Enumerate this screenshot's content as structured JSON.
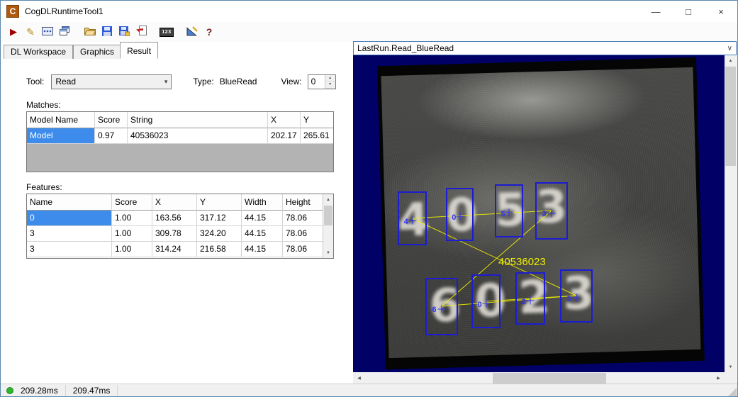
{
  "window": {
    "title": "CogDLRuntimeTool1",
    "icon_letter": "C",
    "controls": {
      "minimize": "—",
      "maximize": "□",
      "close": "×"
    }
  },
  "icons": {
    "play": "▶",
    "pencil": "✎",
    "numbers": "123",
    "help": "?",
    "combo_arrow": "▾",
    "selector_chevron": "∨",
    "spinner_up": "▲",
    "spinner_down": "▼",
    "scroll_up": "▲",
    "scroll_down": "▼",
    "scroll_left": "◀",
    "scroll_right": "▶"
  },
  "tabs": {
    "items": [
      {
        "label": "DL Workspace"
      },
      {
        "label": "Graphics"
      },
      {
        "label": "Result"
      }
    ]
  },
  "result_panel": {
    "tool_label": "Tool:",
    "tool_value": "Read",
    "type_label": "Type:",
    "type_value": "BlueRead",
    "view_label": "View:",
    "view_value": "0",
    "matches_label": "Matches:",
    "matches_table": {
      "headers": [
        "Model Name",
        "Score",
        "String",
        "X",
        "Y"
      ],
      "rows": [
        [
          "Model",
          "0.97",
          "40536023",
          "202.17",
          "265.61"
        ]
      ]
    },
    "features_label": "Features:",
    "features_table": {
      "headers": [
        "Name",
        "Score",
        "X",
        "Y",
        "Width",
        "Height"
      ],
      "rows": [
        [
          "0",
          "1.00",
          "163.56",
          "317.12",
          "44.15",
          "78.06"
        ],
        [
          "3",
          "1.00",
          "309.78",
          "324.20",
          "44.15",
          "78.06"
        ],
        [
          "3",
          "1.00",
          "314.24",
          "216.58",
          "44.15",
          "78.06"
        ]
      ]
    }
  },
  "display_panel": {
    "selector_value": "LastRun.Read_BlueRead",
    "overlay_string": "40536023",
    "boxes": [
      {
        "label": "4"
      },
      {
        "label": "0"
      },
      {
        "label": "5"
      },
      {
        "label": "3"
      },
      {
        "label": "6"
      },
      {
        "label": "0"
      },
      {
        "label": "2"
      },
      {
        "label": "3"
      }
    ],
    "photo_digits": [
      "4",
      "0",
      "5",
      "3",
      "6",
      "0",
      "2",
      "3"
    ]
  },
  "status_bar": {
    "time1": "209.28ms",
    "time2": "209.47ms"
  },
  "colors": {
    "selection": "#3d8ceb",
    "image_bg": "#000066",
    "box_blue": "#1c1cd0",
    "label_blue": "#3030ff",
    "overlay_yellow": "#f0f000",
    "status_green": "#2db52d",
    "filler_gray": "#b3b3b3"
  }
}
